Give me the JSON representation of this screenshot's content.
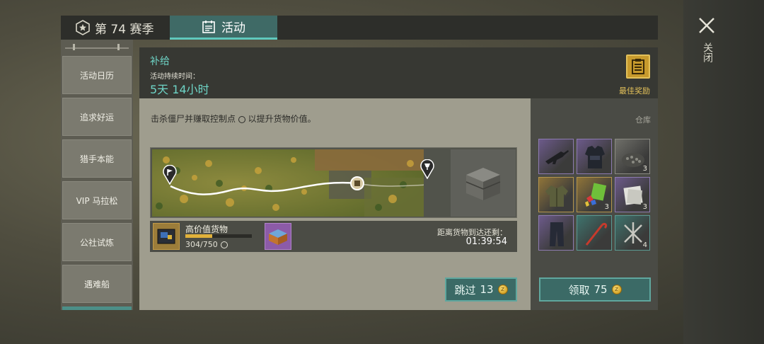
{
  "tabs": {
    "season_label": "第 74 赛季",
    "activity_label": "活动"
  },
  "close": {
    "label": "关闭"
  },
  "nav": {
    "items": [
      {
        "label": "活动日历"
      },
      {
        "label": "追求好运"
      },
      {
        "label": "猎手本能"
      },
      {
        "label": "VIP 马拉松"
      },
      {
        "label": "公社试炼"
      },
      {
        "label": "遇难船"
      }
    ]
  },
  "header": {
    "title": "补给",
    "duration_label": "活动持续时间：",
    "duration_value": "5天 14小时",
    "best_reward_label": "最佳奖励"
  },
  "main": {
    "description": "击杀僵尸并赚取控制点",
    "description_suffix": "以提升货物价值。",
    "cargo": {
      "name": "高价值货物",
      "progress_text": "304/750",
      "progress_current": 304,
      "progress_max": 750
    },
    "arrival_label": "距离货物到达还剩：",
    "arrival_time": "01:39:54",
    "skip_button": {
      "label": "跳过",
      "cost": "13"
    }
  },
  "warehouse": {
    "label": "仓库",
    "slots": [
      {
        "item": "assault-rifle",
        "rarity": "purple",
        "qty": ""
      },
      {
        "item": "tactical-vest",
        "rarity": "purple",
        "qty": ""
      },
      {
        "item": "gravel",
        "rarity": "grey",
        "qty": "3"
      },
      {
        "item": "jacket",
        "rarity": "gold",
        "qty": ""
      },
      {
        "item": "gem-book",
        "rarity": "gold",
        "qty": "3"
      },
      {
        "item": "fabric",
        "rarity": "purple",
        "qty": "3"
      },
      {
        "item": "pants",
        "rarity": "purple",
        "qty": ""
      },
      {
        "item": "crowbar",
        "rarity": "teal",
        "qty": ""
      },
      {
        "item": "nails",
        "rarity": "teal",
        "qty": "4"
      }
    ],
    "claim_button": {
      "label": "领取",
      "cost": "75"
    }
  },
  "colors": {
    "accent_teal": "#6ed4c6",
    "tab_active": "#3f6a66",
    "gold": "#e3c15a"
  }
}
